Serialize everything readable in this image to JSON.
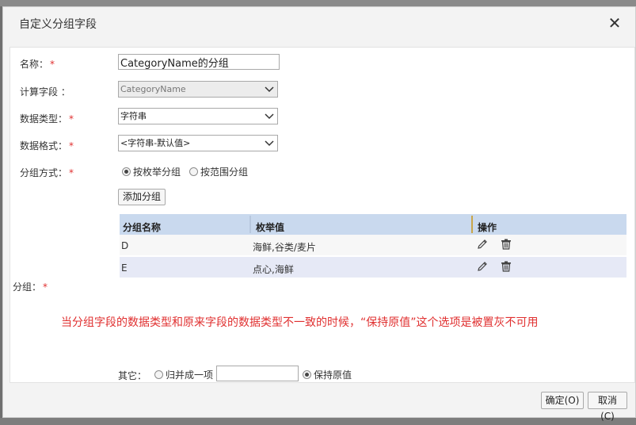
{
  "dialog": {
    "title": "自定义分组字段",
    "close_glyph": "✕"
  },
  "form": {
    "name": {
      "label": "名称：",
      "required_mark": "*",
      "value": "CategoryName的分组"
    },
    "calc_field": {
      "label": "计算字段 ：",
      "value": "CategoryName"
    },
    "data_type": {
      "label": "数据类型：",
      "required_mark": "*",
      "value": "字符串"
    },
    "data_format": {
      "label": "数据格式：",
      "required_mark": "*",
      "value": "<字符串-默认值>"
    },
    "group_method": {
      "label": "分组方式：",
      "required_mark": "*",
      "options": [
        {
          "label": "按枚举分组",
          "checked": true
        },
        {
          "label": "按范围分组",
          "checked": false
        }
      ]
    },
    "add_group_label": "添加分组",
    "group_label": "分组：",
    "group_required_mark": "*"
  },
  "grid": {
    "columns": [
      "分组名称",
      "枚举值",
      "操作"
    ],
    "rows": [
      {
        "name": "D",
        "values": "海鲜,谷类/麦片"
      },
      {
        "name": "E",
        "values": "点心,海鲜"
      }
    ],
    "icons": [
      "pencil-icon",
      "trash-icon"
    ]
  },
  "note": "当分组字段的数据类型和原来字段的数据类型不一致的时候，“保持原值”这个选项是被置灰不可用",
  "other": {
    "label": "其它：",
    "merge_label": "归并成一项",
    "merge_value": "",
    "keep_label": "保持原值",
    "merge_checked": false,
    "keep_checked": true
  },
  "footer": {
    "ok_label": "确定(O)",
    "cancel_label": "取消(C)"
  }
}
